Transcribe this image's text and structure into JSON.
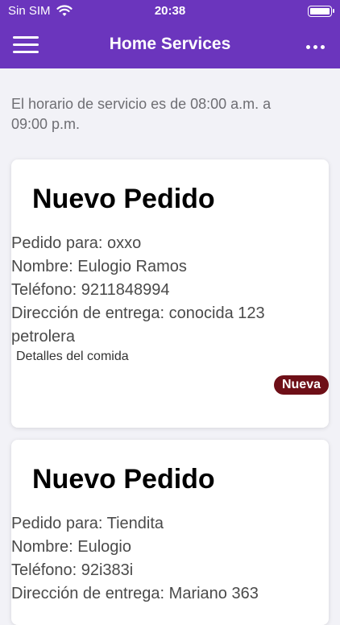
{
  "status_bar": {
    "carrier": "Sin SIM",
    "time": "20:38"
  },
  "nav": {
    "title": "Home Services"
  },
  "schedule_text": "El horario de servicio es de 08:00 a.m. a 09:00 p.m.",
  "orders": [
    {
      "title": "Nuevo Pedido",
      "pedido_para": "Pedido para: oxxo",
      "nombre": "Nombre: Eulogio Ramos",
      "telefono": "Teléfono: 9211848994",
      "direccion": "Dirección de entrega: conocida 123 petrolera",
      "detalles": "Detalles del comida",
      "badge": "Nueva"
    },
    {
      "title": "Nuevo Pedido",
      "pedido_para": "Pedido para: Tiendita",
      "nombre": "Nombre: Eulogio",
      "telefono": "Teléfono: 92i383i",
      "direccion": "Dirección de entrega: Mariano 363"
    }
  ],
  "colors": {
    "header": "#6b35bd",
    "badge": "#6e0f17",
    "background": "#f2f2f7"
  }
}
